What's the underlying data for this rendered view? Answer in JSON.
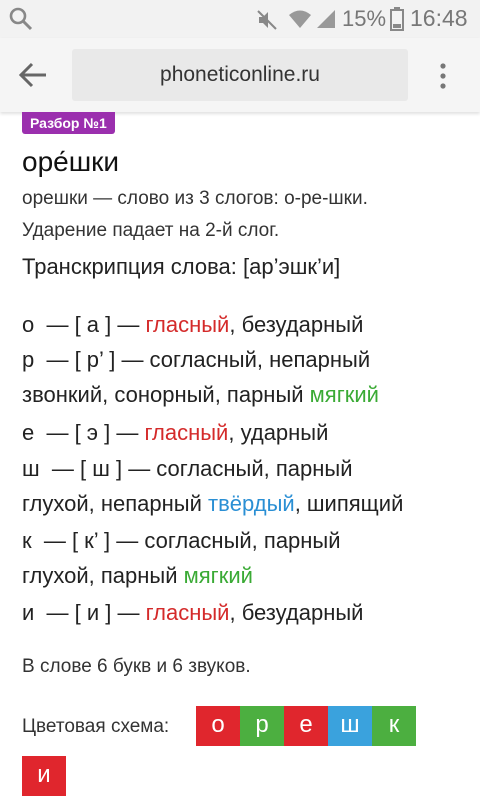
{
  "status_bar": {
    "battery": "15%",
    "time": "16:48",
    "icons": [
      "search-icon",
      "mute-icon",
      "wifi-icon",
      "signal-icon",
      "battery-icon"
    ]
  },
  "app_bar": {
    "url": "phoneticonline.ru"
  },
  "badge": "Разбор №1",
  "word": "оре́шки",
  "info_line1": "орешки — слово из 3 слогов: о-ре-шки.",
  "info_line2": "Ударение падает на 2-й слог.",
  "transcription": "Транскрипция слова: [ар’эшк’и]",
  "letters": [
    {
      "pre": "о  — [ а ] — ",
      "hl": "гласный",
      "post": ", безударный"
    },
    {
      "pre": "р  — [ р’ ] — согласный, непарный",
      "hl": "",
      "post": ""
    },
    {
      "pre": "звонкий, сонорный, парный ",
      "hl": "мягкий",
      "post": ""
    },
    {
      "pre": "е  — [ э ] — ",
      "hl": "гласный",
      "post": ", ударный"
    },
    {
      "pre": "ш  — [ ш ] — согласный, парный",
      "hl": "",
      "post": ""
    },
    {
      "pre": "глухой, непарный ",
      "hl": "твёрдый",
      "post": ", шипящий"
    },
    {
      "pre": "к  — [ к’ ] — согласный, парный",
      "hl": "",
      "post": ""
    },
    {
      "pre": "глухой, парный ",
      "hl": "мягкий",
      "post": ""
    },
    {
      "pre": "и  — [ и ] — ",
      "hl": "гласный",
      "post": ", безударный"
    }
  ],
  "summary": "В слове 6 букв и 6 звуков.",
  "scheme_label": "Цветовая схема:",
  "scheme_tiles": [
    {
      "letter": "о",
      "color": "#e0262d"
    },
    {
      "letter": "р",
      "color": "#4caf40"
    },
    {
      "letter": "е",
      "color": "#e0262d"
    },
    {
      "letter": "ш",
      "color": "#3aa2dd"
    },
    {
      "letter": "к",
      "color": "#4caf40"
    },
    {
      "letter": "и",
      "color": "#e0262d"
    }
  ],
  "colors": {
    "vowel": "#d42a2a",
    "soft": "#3aaa35",
    "hard": "#2a8fd4",
    "badge": "#9b2fae"
  }
}
